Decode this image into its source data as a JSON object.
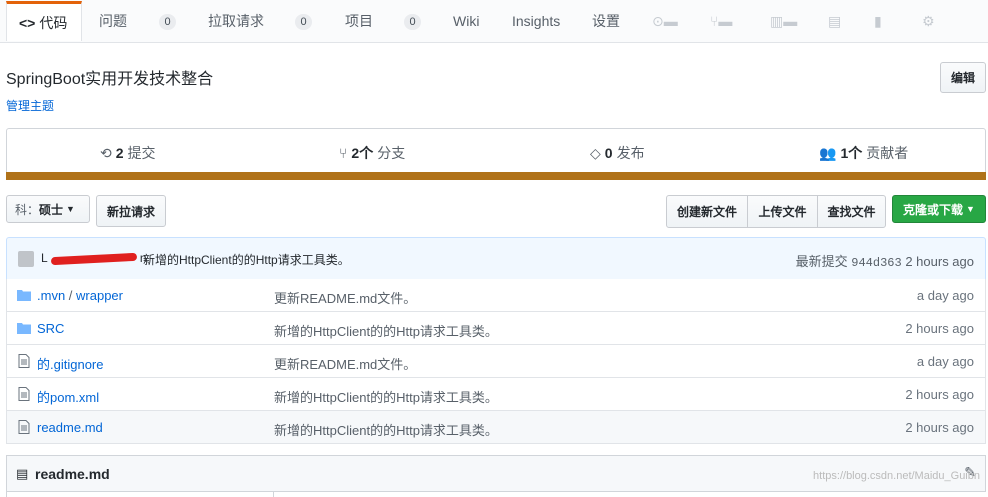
{
  "nav": {
    "tabs": [
      {
        "label": "代码"
      },
      {
        "label": "问题",
        "count": "0"
      },
      {
        "label": "拉取请求",
        "count": "0"
      },
      {
        "label": "项目",
        "count": "0"
      },
      {
        "label": "Wiki"
      },
      {
        "label": "Insights"
      },
      {
        "label": "设置"
      }
    ],
    "code_icon": "<>"
  },
  "repo": {
    "description": "SpringBoot实用开发技术整合",
    "manage_topics": "管理主题",
    "edit_button": "编辑"
  },
  "stats": {
    "commits_count": "2",
    "commits_label": "提交",
    "branches_count": "2个",
    "branches_label": "分支",
    "releases_count": "0",
    "releases_label": "发布",
    "contributors_count": "1个",
    "contributors_label": "贡献者",
    "language_color": "#b07219"
  },
  "toolbar": {
    "branch_prefix": "科：",
    "branch_name": "硕士",
    "new_pull_request": "新拉请求",
    "create_new_file": "创建新文件",
    "upload_files": "上传文件",
    "find_file": "查找文件",
    "clone_download": "克隆或下载",
    "clone_color": "#28a745"
  },
  "latest_commit": {
    "author_partial": "L",
    "author_suffix": "n",
    "message": "新增的HttpClient的的Http请求工具类。",
    "label": "最新提交",
    "sha": "944d363",
    "age": "2 hours ago"
  },
  "files": [
    {
      "type": "folder",
      "name_a": ".mvn",
      "sep": " / ",
      "name_b": "wrapper",
      "message": "更新README.md文件。",
      "age": "a day ago"
    },
    {
      "type": "folder",
      "name_a": "SRC",
      "message": "新增的HttpClient的的Http请求工具类。",
      "age": "2 hours ago"
    },
    {
      "type": "file",
      "name_a": "的.gitignore",
      "message": "更新README.md文件。",
      "age": "a day ago"
    },
    {
      "type": "file",
      "name_a": "的pom.xml",
      "message": "新增的HttpClient的的Http请求工具类。",
      "age": "2 hours ago"
    },
    {
      "type": "file",
      "name_a": "readme.md",
      "message": "新增的HttpClient的的Http请求工具类。",
      "age": "2 hours ago"
    }
  ],
  "readme": {
    "title": "readme.md"
  },
  "watermark": "https://blog.csdn.net/Maidu_Guibn"
}
